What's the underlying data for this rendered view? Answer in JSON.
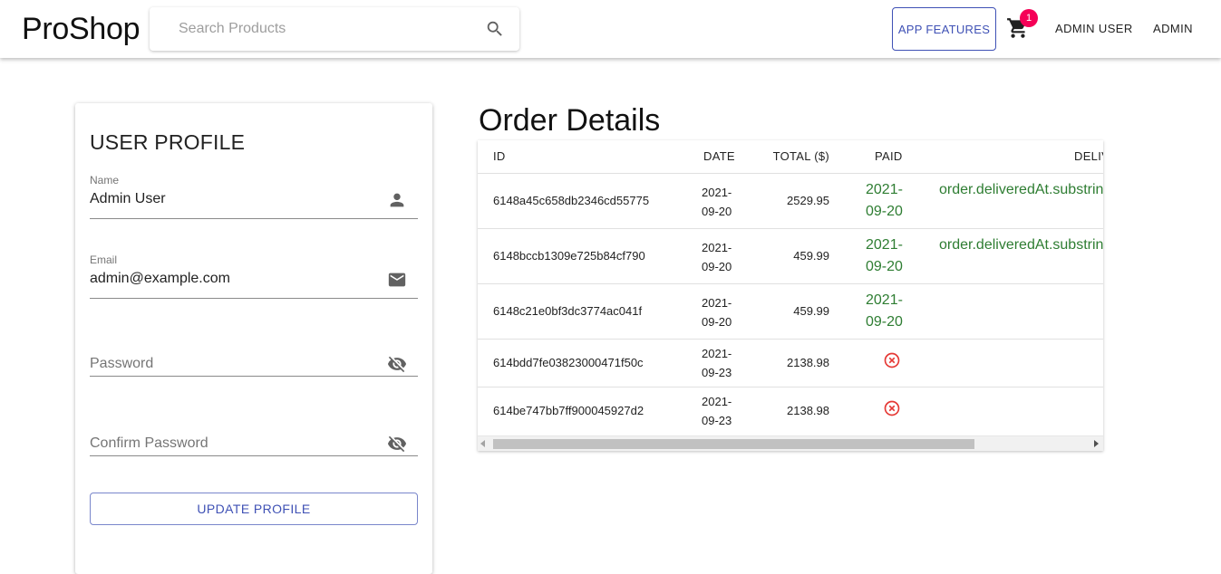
{
  "header": {
    "brand": "ProShop",
    "search_placeholder": "Search Products",
    "features_label": "APP FEATURES",
    "cart_count": "1",
    "user_menu": "ADMIN USER",
    "admin_menu": "ADMIN"
  },
  "profile": {
    "title": "USER PROFILE",
    "name_label": "Name",
    "name_value": "Admin User",
    "email_label": "Email",
    "email_value": "admin@example.com",
    "password_placeholder": "Password",
    "confirm_placeholder": "Confirm Password",
    "update_label": "UPDATE PROFILE"
  },
  "orders": {
    "title": "Order Details",
    "columns": [
      "ID",
      "DATE",
      "TOTAL ($)",
      "PAID",
      "DELIV"
    ],
    "rows": [
      {
        "id": "6148a45c658db2346cd55775",
        "date": "2021-09-20",
        "total": "2529.95",
        "paid": "2021-09-20",
        "delivered": "order.deliveredAt.substrin"
      },
      {
        "id": "6148bccb1309e725b84cf790",
        "date": "2021-09-20",
        "total": "459.99",
        "paid": "2021-09-20",
        "delivered": "order.deliveredAt.substrin"
      },
      {
        "id": "6148c21e0bf3dc3774ac041f",
        "date": "2021-09-20",
        "total": "459.99",
        "paid": "2021-09-20",
        "delivered": ""
      },
      {
        "id": "614bdd7fe03823000471f50c",
        "date": "2021-09-23",
        "total": "2138.98",
        "paid": "",
        "delivered": ""
      },
      {
        "id": "614be747bb7ff900045927d2",
        "date": "2021-09-23",
        "total": "2138.98",
        "paid": "",
        "delivered": ""
      }
    ],
    "unpaid_icon": "cancel-circle-icon"
  },
  "colors": {
    "primary": "#3f51b5",
    "badge": "#f50057",
    "paid_green": "#2e7d32",
    "unpaid_red": "#e53935"
  }
}
